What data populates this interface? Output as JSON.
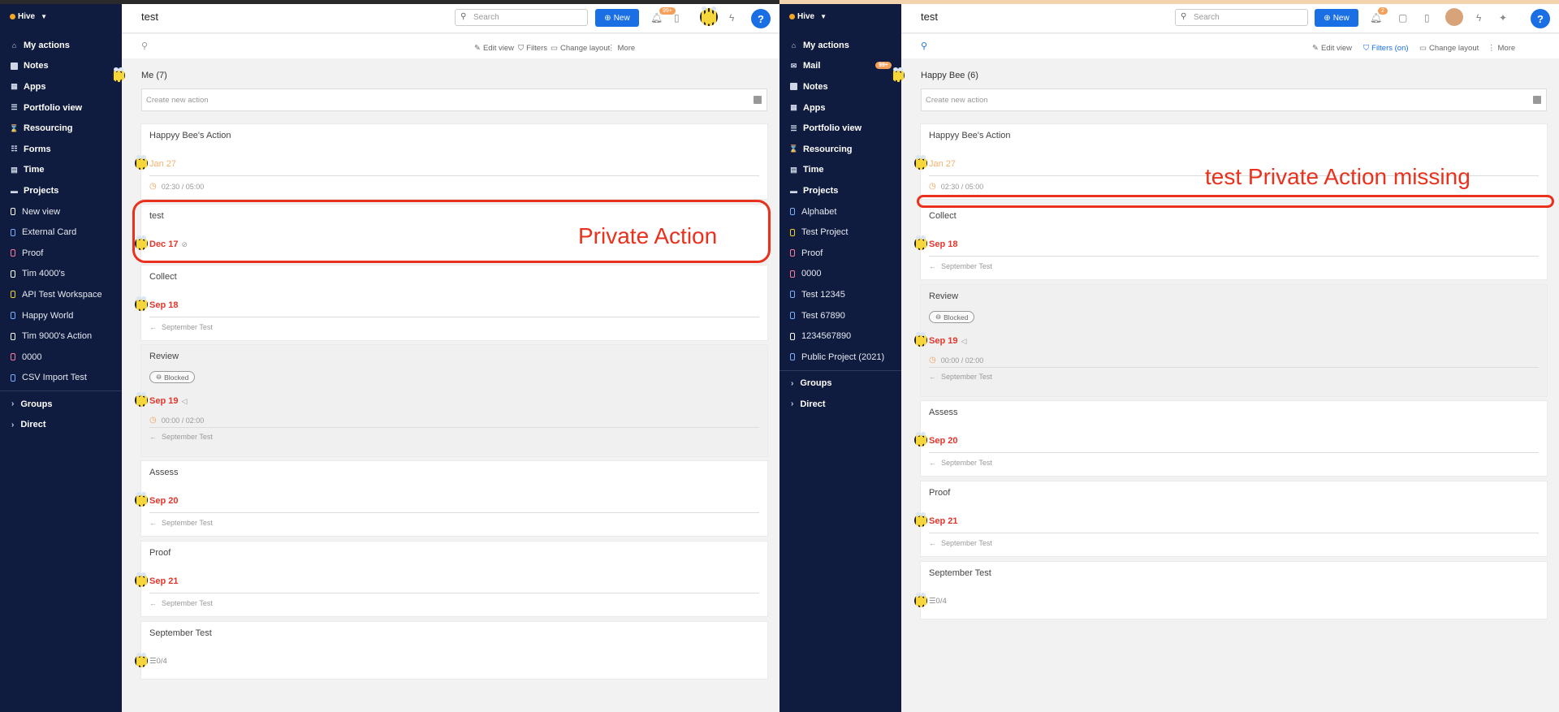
{
  "left": {
    "brand": "Hive",
    "nav": [
      {
        "label": "My actions",
        "icon": "home-icon"
      },
      {
        "label": "Notes",
        "icon": "note-icon"
      },
      {
        "label": "Apps",
        "icon": "grid-icon"
      },
      {
        "label": "Portfolio view",
        "icon": "list-icon"
      },
      {
        "label": "Resourcing",
        "icon": "hourglass-icon"
      },
      {
        "label": "Forms",
        "icon": "form-icon"
      },
      {
        "label": "Time",
        "icon": "calendar-icon"
      },
      {
        "label": "Projects",
        "icon": "folder-icon"
      }
    ],
    "projects": [
      {
        "label": "New view",
        "color": "#ffffff"
      },
      {
        "label": "External Card",
        "color": "#7ab0ff"
      },
      {
        "label": "Proof",
        "color": "#ff7a9a"
      },
      {
        "label": "Tim 4000's",
        "color": "#ffffff"
      },
      {
        "label": "API Test Workspace",
        "color": "#f5d020"
      },
      {
        "label": "Happy World",
        "color": "#7ab0ff"
      },
      {
        "label": "Tim 9000's Action",
        "color": "#ffffff"
      },
      {
        "label": "0000",
        "color": "#ff7a9a"
      },
      {
        "label": "CSV Import Test",
        "color": "#7ab0ff"
      }
    ],
    "groups": [
      {
        "label": "Groups"
      },
      {
        "label": "Direct"
      }
    ],
    "header": {
      "title": "test",
      "search_placeholder": "Search",
      "new_label": "New",
      "notif_badge": "99+"
    },
    "toolbar": {
      "edit": "Edit view",
      "filters": "Filters",
      "layout": "Change layout",
      "more": "More"
    },
    "column": {
      "title": "Me (7)",
      "create_placeholder": "Create new action"
    },
    "cards": [
      {
        "title": "Happyy Bee's Action",
        "date": "Jan 27",
        "time": "02:30 / 05:00"
      },
      {
        "title": "test",
        "date": "Dec 17"
      },
      {
        "title": "Collect",
        "date": "Sep 18",
        "parent": "September Test"
      },
      {
        "title": "Review",
        "blocked": "Blocked",
        "date": "Sep 19",
        "time": "00:00 / 02:00",
        "parent": "September Test"
      },
      {
        "title": "Assess",
        "date": "Sep 20",
        "parent": "September Test"
      },
      {
        "title": "Proof",
        "date": "Sep 21",
        "parent": "September Test"
      },
      {
        "title": "September Test",
        "checklist": "0/4"
      }
    ],
    "annotation": "Private Action"
  },
  "right": {
    "brand": "Hive",
    "nav": [
      {
        "label": "My actions",
        "icon": "home-icon"
      },
      {
        "label": "Mail",
        "icon": "mail-icon",
        "badge": "99+"
      },
      {
        "label": "Notes",
        "icon": "note-icon"
      },
      {
        "label": "Apps",
        "icon": "grid-icon"
      },
      {
        "label": "Portfolio view",
        "icon": "list-icon"
      },
      {
        "label": "Resourcing",
        "icon": "hourglass-icon"
      },
      {
        "label": "Time",
        "icon": "calendar-icon"
      },
      {
        "label": "Projects",
        "icon": "folder-icon"
      }
    ],
    "projects": [
      {
        "label": "Alphabet",
        "color": "#7ab0ff"
      },
      {
        "label": "Test Project",
        "color": "#f5d020"
      },
      {
        "label": "Proof",
        "color": "#ff7a9a"
      },
      {
        "label": "0000",
        "color": "#ff7a9a"
      },
      {
        "label": "Test 12345",
        "color": "#7ab0ff"
      },
      {
        "label": "Test 67890",
        "color": "#7ab0ff"
      },
      {
        "label": "1234567890",
        "color": "#ffffff"
      },
      {
        "label": "Public Project (2021)",
        "color": "#7ab0ff"
      }
    ],
    "groups": [
      {
        "label": "Groups"
      },
      {
        "label": "Direct"
      }
    ],
    "header": {
      "title": "test",
      "search_placeholder": "Search",
      "new_label": "New",
      "notif_badge": "2"
    },
    "toolbar": {
      "edit": "Edit view",
      "filters": "Filters (on)",
      "layout": "Change layout",
      "more": "More"
    },
    "column": {
      "title": "Happy Bee (6)",
      "create_placeholder": "Create new action"
    },
    "cards": [
      {
        "title": "Happyy Bee's Action",
        "date": "Jan 27",
        "time": "02:30 / 05:00"
      },
      {
        "title": "Collect",
        "date": "Sep 18",
        "parent": "September Test"
      },
      {
        "title": "Review",
        "blocked": "Blocked",
        "date": "Sep 19",
        "time": "00:00 / 02:00",
        "parent": "September Test"
      },
      {
        "title": "Assess",
        "date": "Sep 20",
        "parent": "September Test"
      },
      {
        "title": "Proof",
        "date": "Sep 21",
        "parent": "September Test"
      },
      {
        "title": "September Test",
        "checklist": "0/4"
      }
    ],
    "annotation": "test Private Action missing"
  },
  "colors": {
    "sidebar": "#0f1c3f",
    "accent": "#1a6fe5",
    "due": "#e5352b",
    "annotation": "#e8321e",
    "badge": "#f5a05a"
  }
}
